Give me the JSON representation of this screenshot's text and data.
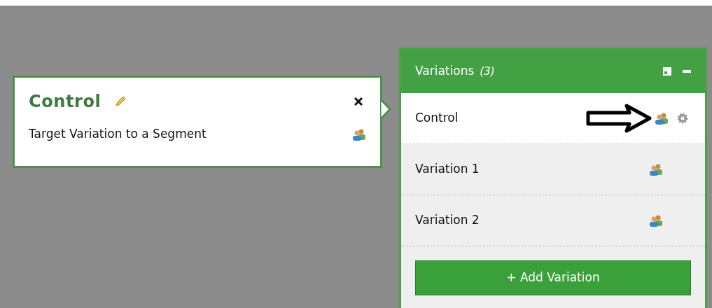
{
  "popup": {
    "title": "Control",
    "action": "Target Variation to a Segment"
  },
  "panel": {
    "title": "Variations",
    "count": "(3)",
    "rows": [
      {
        "label": "Control",
        "selected": true,
        "settings": true
      },
      {
        "label": "Variation 1",
        "selected": false,
        "settings": false
      },
      {
        "label": "Variation 2",
        "selected": false,
        "settings": false
      }
    ],
    "add_button": "+ Add Variation"
  }
}
